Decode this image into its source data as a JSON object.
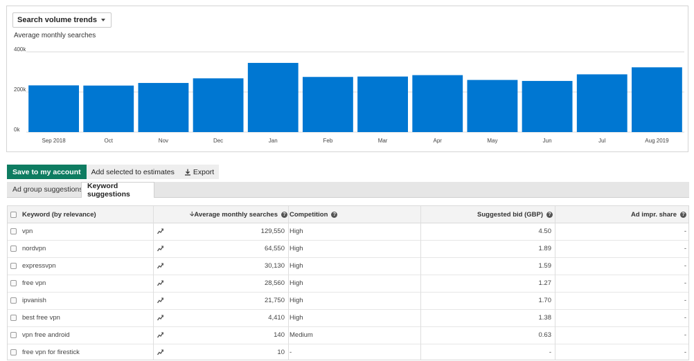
{
  "chart_panel": {
    "dropdown_label": "Search volume trends",
    "subtitle": "Average monthly searches"
  },
  "chart_data": {
    "type": "bar",
    "title": "",
    "ylabel": "Average monthly searches",
    "ylim": [
      0,
      400000
    ],
    "ytick_labels": [
      "0k",
      "200k",
      "400k"
    ],
    "ytick_values": [
      0,
      200000,
      400000
    ],
    "categories": [
      "Sep 2018",
      "Oct",
      "Nov",
      "Dec",
      "Jan",
      "Feb",
      "Mar",
      "Apr",
      "May",
      "Jun",
      "Jul",
      "Aug 2019"
    ],
    "values": [
      233000,
      232000,
      245000,
      268000,
      345000,
      275000,
      277000,
      284000,
      260000,
      255000,
      288000,
      323000
    ],
    "color": "#0077d2",
    "grid": true
  },
  "toolbar": {
    "save_label": "Save to my account",
    "add_estimates_label": "Add selected to estimates",
    "export_label": "Export",
    "export_icon": "download-icon"
  },
  "tabs": [
    {
      "label": "Ad group suggestions",
      "active": false
    },
    {
      "label": "Keyword suggestions",
      "active": true
    }
  ],
  "table": {
    "headers": {
      "keyword": "Keyword (by relevance)",
      "searches": "Average monthly searches",
      "competition": "Competition",
      "bid": "Suggested bid (GBP)",
      "share": "Ad impr. share"
    },
    "rows": [
      {
        "keyword": "vpn",
        "searches": "129,550",
        "competition": "High",
        "bid": "4.50",
        "share": "-"
      },
      {
        "keyword": "nordvpn",
        "searches": "64,550",
        "competition": "High",
        "bid": "1.89",
        "share": "-"
      },
      {
        "keyword": "expressvpn",
        "searches": "30,130",
        "competition": "High",
        "bid": "1.59",
        "share": "-"
      },
      {
        "keyword": "free vpn",
        "searches": "28,560",
        "competition": "High",
        "bid": "1.27",
        "share": "-"
      },
      {
        "keyword": "ipvanish",
        "searches": "21,750",
        "competition": "High",
        "bid": "1.70",
        "share": "-"
      },
      {
        "keyword": "best free vpn",
        "searches": "4,410",
        "competition": "High",
        "bid": "1.38",
        "share": "-"
      },
      {
        "keyword": "vpn free android",
        "searches": "140",
        "competition": "Medium",
        "bid": "0.63",
        "share": "-"
      },
      {
        "keyword": "free vpn for firestick",
        "searches": "10",
        "competition": "-",
        "bid": "-",
        "share": "-"
      }
    ]
  }
}
